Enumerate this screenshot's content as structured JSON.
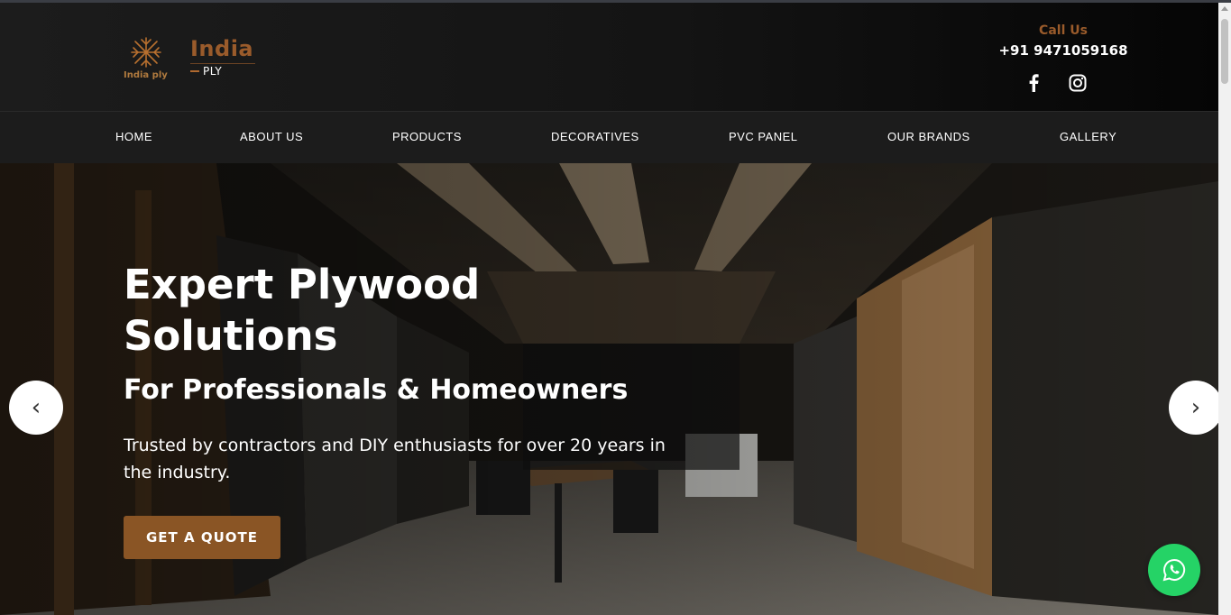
{
  "header": {
    "logo_caption": "India ply",
    "logo_name": "India",
    "logo_sub": "PLY",
    "call_label": "Call Us",
    "phone": "+91 9471059168",
    "socials": [
      {
        "icon": "facebook-icon"
      },
      {
        "icon": "instagram-icon"
      }
    ]
  },
  "nav": {
    "items": [
      {
        "label": "HOME"
      },
      {
        "label": "ABOUT US"
      },
      {
        "label": "PRODUCTS"
      },
      {
        "label": "DECORATIVES"
      },
      {
        "label": "PVC PANEL"
      },
      {
        "label": "OUR BRANDS"
      },
      {
        "label": "GALLERY"
      }
    ]
  },
  "hero": {
    "title": "Expert Plywood Solutions",
    "subtitle": "For Professionals & Homeowners",
    "description": "Trusted by contractors and DIY enthusiasts for over 20 years in the industry.",
    "cta_label": "GET A QUOTE",
    "prev_arrow": "‹",
    "next_arrow": "›"
  },
  "colors": {
    "accent": "#9a5b2b",
    "button": "#8a5525",
    "nav_bg": "#1c1c1c",
    "whatsapp": "#25d366"
  },
  "floating": {
    "icon": "whatsapp-icon"
  }
}
